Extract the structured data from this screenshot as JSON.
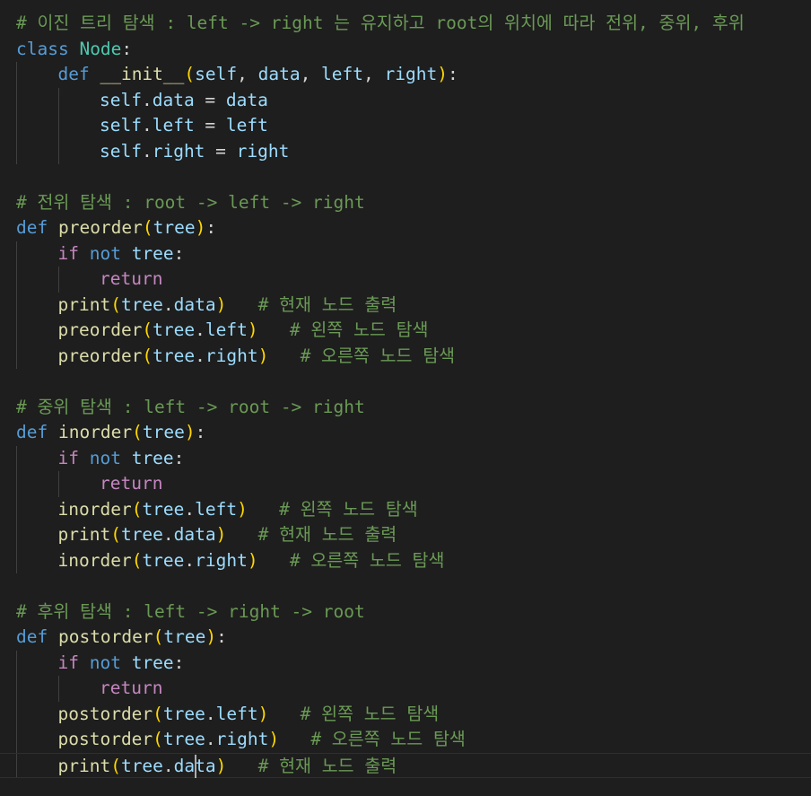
{
  "editor": {
    "colors": {
      "background": "#1e1e1e",
      "comment": "#6a9955",
      "keyword": "#569cd6",
      "control": "#c586c0",
      "function": "#dcdcaa",
      "variable": "#9cdcfe",
      "class_name": "#4ec9b0",
      "plain": "#d4d4d4",
      "bracket_1": "#ffd700",
      "bracket_2": "#da70d6",
      "indent_guide": "#404040",
      "cursor": "#aeafad"
    },
    "cursor": {
      "line": 29,
      "char": 13
    },
    "lines": [
      {
        "indent": 0,
        "tokens": [
          [
            "comment",
            "# 이진 트리 탐색 : left -> right 는 유지하고 root의 위치에 따라 전위, 중위, 후위"
          ]
        ]
      },
      {
        "indent": 0,
        "tokens": [
          [
            "keyword",
            "class "
          ],
          [
            "class_name",
            "Node"
          ],
          [
            "plain",
            ":"
          ]
        ]
      },
      {
        "indent": 1,
        "tokens": [
          [
            "keyword",
            "def "
          ],
          [
            "function",
            "__init__"
          ],
          [
            "bracket_1",
            "("
          ],
          [
            "variable",
            "self"
          ],
          [
            "plain",
            ", "
          ],
          [
            "variable",
            "data"
          ],
          [
            "plain",
            ", "
          ],
          [
            "variable",
            "left"
          ],
          [
            "plain",
            ", "
          ],
          [
            "variable",
            "right"
          ],
          [
            "bracket_1",
            ")"
          ],
          [
            "plain",
            ":"
          ]
        ]
      },
      {
        "indent": 2,
        "tokens": [
          [
            "variable",
            "self"
          ],
          [
            "plain",
            "."
          ],
          [
            "variable",
            "data"
          ],
          [
            "plain",
            " = "
          ],
          [
            "variable",
            "data"
          ]
        ]
      },
      {
        "indent": 2,
        "tokens": [
          [
            "variable",
            "self"
          ],
          [
            "plain",
            "."
          ],
          [
            "variable",
            "left"
          ],
          [
            "plain",
            " = "
          ],
          [
            "variable",
            "left"
          ]
        ]
      },
      {
        "indent": 2,
        "tokens": [
          [
            "variable",
            "self"
          ],
          [
            "plain",
            "."
          ],
          [
            "variable",
            "right"
          ],
          [
            "plain",
            " = "
          ],
          [
            "variable",
            "right"
          ]
        ]
      },
      {
        "indent": 0,
        "tokens": []
      },
      {
        "indent": 0,
        "tokens": [
          [
            "comment",
            "# 전위 탐색 : root -> left -> right"
          ]
        ]
      },
      {
        "indent": 0,
        "tokens": [
          [
            "keyword",
            "def "
          ],
          [
            "function",
            "preorder"
          ],
          [
            "bracket_1",
            "("
          ],
          [
            "variable",
            "tree"
          ],
          [
            "bracket_1",
            ")"
          ],
          [
            "plain",
            ":"
          ]
        ]
      },
      {
        "indent": 1,
        "tokens": [
          [
            "control",
            "if "
          ],
          [
            "keyword",
            "not "
          ],
          [
            "variable",
            "tree"
          ],
          [
            "plain",
            ":"
          ]
        ]
      },
      {
        "indent": 2,
        "tokens": [
          [
            "control",
            "return"
          ]
        ]
      },
      {
        "indent": 1,
        "tokens": [
          [
            "function",
            "print"
          ],
          [
            "bracket_1",
            "("
          ],
          [
            "variable",
            "tree"
          ],
          [
            "plain",
            "."
          ],
          [
            "variable",
            "data"
          ],
          [
            "bracket_1",
            ")"
          ],
          [
            "plain",
            "   "
          ],
          [
            "comment",
            "# 현재 노드 출력"
          ]
        ]
      },
      {
        "indent": 1,
        "tokens": [
          [
            "function",
            "preorder"
          ],
          [
            "bracket_1",
            "("
          ],
          [
            "variable",
            "tree"
          ],
          [
            "plain",
            "."
          ],
          [
            "variable",
            "left"
          ],
          [
            "bracket_1",
            ")"
          ],
          [
            "plain",
            "   "
          ],
          [
            "comment",
            "# 왼쪽 노드 탐색"
          ]
        ]
      },
      {
        "indent": 1,
        "tokens": [
          [
            "function",
            "preorder"
          ],
          [
            "bracket_1",
            "("
          ],
          [
            "variable",
            "tree"
          ],
          [
            "plain",
            "."
          ],
          [
            "variable",
            "right"
          ],
          [
            "bracket_1",
            ")"
          ],
          [
            "plain",
            "   "
          ],
          [
            "comment",
            "# 오른쪽 노드 탐색"
          ]
        ]
      },
      {
        "indent": 0,
        "tokens": []
      },
      {
        "indent": 0,
        "tokens": [
          [
            "comment",
            "# 중위 탐색 : left -> root -> right"
          ]
        ]
      },
      {
        "indent": 0,
        "tokens": [
          [
            "keyword",
            "def "
          ],
          [
            "function",
            "inorder"
          ],
          [
            "bracket_1",
            "("
          ],
          [
            "variable",
            "tree"
          ],
          [
            "bracket_1",
            ")"
          ],
          [
            "plain",
            ":"
          ]
        ]
      },
      {
        "indent": 1,
        "tokens": [
          [
            "control",
            "if "
          ],
          [
            "keyword",
            "not "
          ],
          [
            "variable",
            "tree"
          ],
          [
            "plain",
            ":"
          ]
        ]
      },
      {
        "indent": 2,
        "tokens": [
          [
            "control",
            "return"
          ]
        ]
      },
      {
        "indent": 1,
        "tokens": [
          [
            "function",
            "inorder"
          ],
          [
            "bracket_1",
            "("
          ],
          [
            "variable",
            "tree"
          ],
          [
            "plain",
            "."
          ],
          [
            "variable",
            "left"
          ],
          [
            "bracket_1",
            ")"
          ],
          [
            "plain",
            "   "
          ],
          [
            "comment",
            "# 왼쪽 노드 탐색"
          ]
        ]
      },
      {
        "indent": 1,
        "tokens": [
          [
            "function",
            "print"
          ],
          [
            "bracket_1",
            "("
          ],
          [
            "variable",
            "tree"
          ],
          [
            "plain",
            "."
          ],
          [
            "variable",
            "data"
          ],
          [
            "bracket_1",
            ")"
          ],
          [
            "plain",
            "   "
          ],
          [
            "comment",
            "# 현재 노드 출력"
          ]
        ]
      },
      {
        "indent": 1,
        "tokens": [
          [
            "function",
            "inorder"
          ],
          [
            "bracket_1",
            "("
          ],
          [
            "variable",
            "tree"
          ],
          [
            "plain",
            "."
          ],
          [
            "variable",
            "right"
          ],
          [
            "bracket_1",
            ")"
          ],
          [
            "plain",
            "   "
          ],
          [
            "comment",
            "# 오른쪽 노드 탐색"
          ]
        ]
      },
      {
        "indent": 0,
        "tokens": []
      },
      {
        "indent": 0,
        "tokens": [
          [
            "comment",
            "# 후위 탐색 : left -> right -> root"
          ]
        ]
      },
      {
        "indent": 0,
        "tokens": [
          [
            "keyword",
            "def "
          ],
          [
            "function",
            "postorder"
          ],
          [
            "bracket_1",
            "("
          ],
          [
            "variable",
            "tree"
          ],
          [
            "bracket_1",
            ")"
          ],
          [
            "plain",
            ":"
          ]
        ]
      },
      {
        "indent": 1,
        "tokens": [
          [
            "control",
            "if "
          ],
          [
            "keyword",
            "not "
          ],
          [
            "variable",
            "tree"
          ],
          [
            "plain",
            ":"
          ]
        ]
      },
      {
        "indent": 2,
        "tokens": [
          [
            "control",
            "return"
          ]
        ]
      },
      {
        "indent": 1,
        "tokens": [
          [
            "function",
            "postorder"
          ],
          [
            "bracket_1",
            "("
          ],
          [
            "variable",
            "tree"
          ],
          [
            "plain",
            "."
          ],
          [
            "variable",
            "left"
          ],
          [
            "bracket_1",
            ")"
          ],
          [
            "plain",
            "   "
          ],
          [
            "comment",
            "# 왼쪽 노드 탐색"
          ]
        ]
      },
      {
        "indent": 1,
        "tokens": [
          [
            "function",
            "postorder"
          ],
          [
            "bracket_1",
            "("
          ],
          [
            "variable",
            "tree"
          ],
          [
            "plain",
            "."
          ],
          [
            "variable",
            "right"
          ],
          [
            "bracket_1",
            ")"
          ],
          [
            "plain",
            "   "
          ],
          [
            "comment",
            "# 오른쪽 노드 탐색"
          ]
        ]
      },
      {
        "indent": 1,
        "tokens": [
          [
            "function",
            "print"
          ],
          [
            "bracket_1",
            "("
          ],
          [
            "variable",
            "tree"
          ],
          [
            "plain",
            "."
          ],
          [
            "variable",
            "data"
          ],
          [
            "bracket_1",
            ")"
          ],
          [
            "plain",
            "   "
          ],
          [
            "comment",
            "# 현재 노드 출력"
          ]
        ]
      }
    ]
  }
}
